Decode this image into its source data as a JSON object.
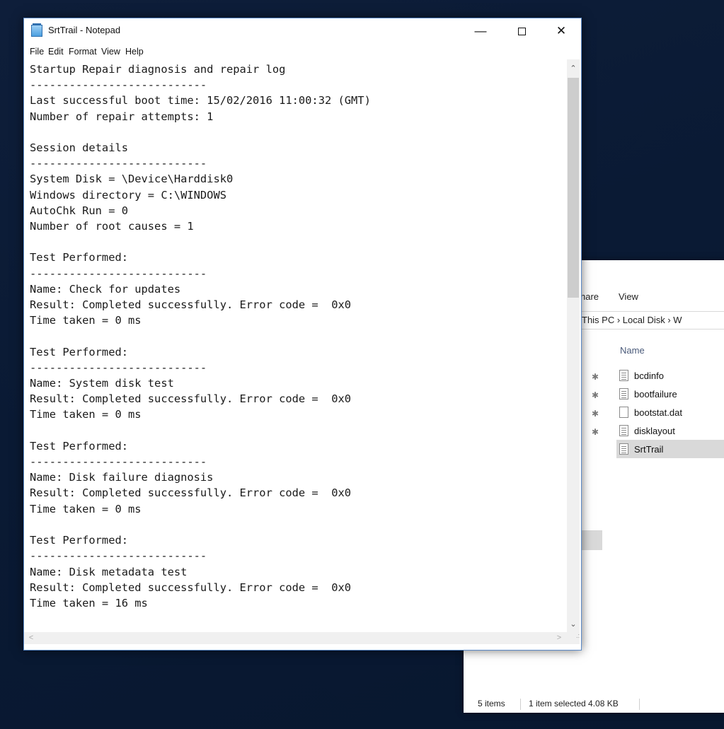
{
  "explorer": {
    "ribbon_tabs": [
      "hare",
      "View"
    ],
    "address": "This PC  ›  Local Disk  ›  W",
    "column_name": "Name",
    "files": [
      {
        "name": "bcdinfo",
        "icon": "text-file-icon",
        "selected": false
      },
      {
        "name": "bootfailure",
        "icon": "text-file-icon",
        "selected": false
      },
      {
        "name": "bootstat.dat",
        "icon": "blank-file-icon",
        "selected": false
      },
      {
        "name": "disklayout",
        "icon": "text-file-icon",
        "selected": false
      },
      {
        "name": "SrtTrail",
        "icon": "text-file-icon",
        "selected": true
      }
    ],
    "status": {
      "items": "5 items",
      "selected": "1 item selected  4.08 KB"
    }
  },
  "notepad": {
    "title": "SrtTrail - Notepad",
    "menu": [
      "File",
      "Edit",
      "Format",
      "View",
      "Help"
    ],
    "lines": [
      "Startup Repair diagnosis and repair log",
      "---------------------------",
      "Last successful boot time: 15/02/2016 11:00:32 (GMT)",
      "Number of repair attempts: 1",
      "",
      "Session details",
      "---------------------------",
      "System Disk = \\Device\\Harddisk0",
      "Windows directory = C:\\WINDOWS",
      "AutoChk Run = 0",
      "Number of root causes = 1",
      "",
      "Test Performed:",
      "---------------------------",
      "Name: Check for updates",
      "Result: Completed successfully. Error code =  0x0",
      "Time taken = 0 ms",
      "",
      "Test Performed:",
      "---------------------------",
      "Name: System disk test",
      "Result: Completed successfully. Error code =  0x0",
      "Time taken = 0 ms",
      "",
      "Test Performed:",
      "---------------------------",
      "Name: Disk failure diagnosis",
      "Result: Completed successfully. Error code =  0x0",
      "Time taken = 0 ms",
      "",
      "Test Performed:",
      "---------------------------",
      "Name: Disk metadata test",
      "Result: Completed successfully. Error code =  0x0",
      "Time taken = 16 ms"
    ]
  }
}
